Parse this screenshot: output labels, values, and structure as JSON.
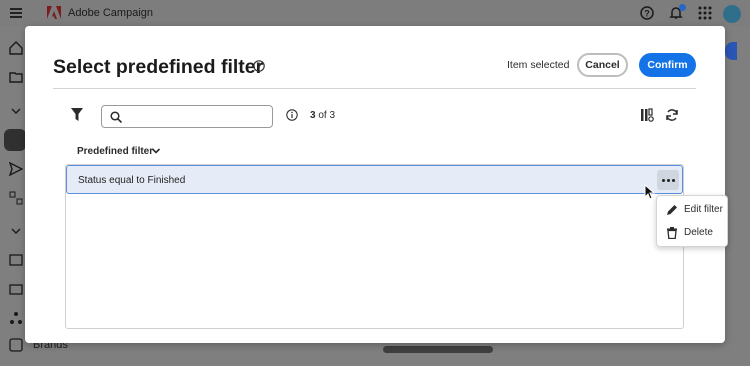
{
  "app": {
    "title": "Adobe Campaign",
    "background_sidebar_item": "Brands"
  },
  "dialog": {
    "title": "Select predefined filter",
    "status": "Item selected",
    "cancel_label": "Cancel",
    "confirm_label": "Confirm"
  },
  "toolbar": {
    "search_value": "",
    "count_current": "3",
    "count_total": "of 3"
  },
  "list": {
    "column_header": "Predefined filter",
    "rows": [
      {
        "label": "Status equal to Finished",
        "selected": true
      }
    ]
  },
  "context_menu": {
    "items": [
      {
        "label": "Edit filter",
        "icon": "pencil-icon"
      },
      {
        "label": "Delete",
        "icon": "trash-icon"
      }
    ]
  },
  "colors": {
    "accent": "#1473e6",
    "selected_row": "#e6ecf7",
    "selected_border": "#5b8fe0"
  }
}
